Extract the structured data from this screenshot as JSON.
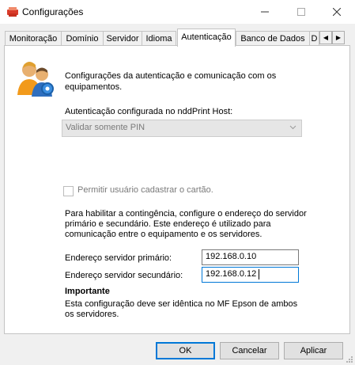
{
  "window": {
    "title": "Configurações",
    "icon": "printer-app-icon",
    "controls": {
      "minimize": "—",
      "maximize": "☐",
      "close": "✕"
    }
  },
  "tabs": [
    {
      "label": "Monitoração"
    },
    {
      "label": "Domínio"
    },
    {
      "label": "Servidor"
    },
    {
      "label": "Idioma"
    },
    {
      "label": "Autenticação",
      "active": true
    },
    {
      "label": "Banco de Dados"
    },
    {
      "label": "D"
    }
  ],
  "tab_scroll": {
    "left": "◀",
    "right": "▶"
  },
  "auth": {
    "header_icon": "users-icon",
    "description": "Configurações da autenticação e comunicação com os equipamentos.",
    "configured_label": "Autenticação configurada no nddPrint Host:",
    "configured_value": "Validar somente PIN",
    "allow_user_card_label": "Permitir usuário cadastrar o cartão.",
    "allow_user_card_checked": false
  },
  "contingency": {
    "info": "Para habilitar a contingência, configure o endereço do servidor primário e secundário. Este endereço é utilizado para comunicação entre o equipamento e os servidores.",
    "primary_label": "Endereço servidor primário:",
    "primary_value": "192.168.0.10",
    "secondary_label": "Endereço servidor secundário:",
    "secondary_value": "192.168.0.12",
    "important_title": "Importante",
    "important_text": "Esta configuração deve ser idêntica no MF Epson de ambos os servidores."
  },
  "buttons": {
    "ok": "OK",
    "cancel": "Cancelar",
    "apply": "Aplicar"
  },
  "colors": {
    "accent": "#0078d7",
    "panel": "#ffffff",
    "window": "#f0f0f0",
    "disabled_text": "#7a7a7a"
  }
}
